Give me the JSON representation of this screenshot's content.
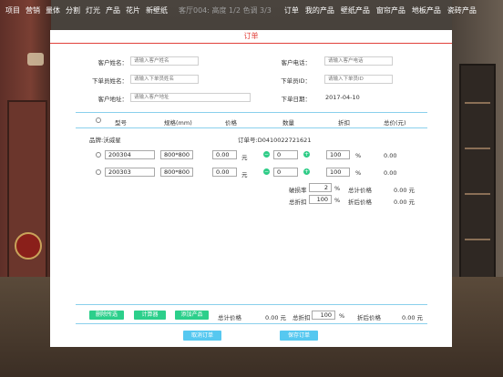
{
  "topbar": {
    "left_menu": [
      "项目",
      "营销",
      "量体",
      "分割",
      "灯光",
      "产品",
      "花片",
      "新壁纸"
    ],
    "scene_info": "客厅004: 高度 1/2 色调 3/3",
    "right_menu": [
      "订单",
      "我的产品",
      "壁纸产品",
      "窗帘产品",
      "地板产品",
      "瓷砖产品"
    ]
  },
  "dialog": {
    "title": "订单",
    "customer_name_label": "客户姓名：",
    "customer_name_placeholder": "请输入客户姓名",
    "customer_phone_label": "客户电话：",
    "customer_phone_placeholder": "请输入客户电话",
    "orderer_name_label": "下单员姓名：",
    "orderer_name_placeholder": "请输入下单员姓名",
    "orderer_id_label": "下单员ID：",
    "orderer_id_placeholder": "请输入下单员ID",
    "customer_address_label": "客户地址：",
    "customer_address_placeholder": "请输入客户地址",
    "order_date_label": "下单日期：",
    "order_date": "2017-04-10"
  },
  "table": {
    "headers": [
      "型号",
      "规格(mm)",
      "价格",
      "数量",
      "折扣",
      "总价(元)"
    ],
    "brand_label": "品牌:沃威星",
    "order_no": "订单号:D0410022721621",
    "rows": [
      {
        "model": "200304",
        "spec": "800*800",
        "price": "0.00",
        "unit": "元",
        "qty": "0",
        "minus": "−",
        "plus": "+",
        "discount": "100",
        "pct": "%",
        "total": "0.00"
      },
      {
        "model": "200303",
        "spec": "800*800",
        "price": "0.00",
        "unit": "元",
        "qty": "0",
        "minus": "−",
        "plus": "+",
        "discount": "100",
        "pct": "%",
        "total": "0.00"
      }
    ]
  },
  "subtotal": {
    "breakage_label": "破损率",
    "breakage_value": "2",
    "breakage_pct": "%",
    "total_price_label": "总计价格",
    "total_price_value": "0.00 元",
    "total_discount_label": "总折扣",
    "total_discount_value": "100",
    "total_discount_pct": "%",
    "discounted_label": "折后价格",
    "discounted_value": "0.00 元"
  },
  "footer": {
    "delete_selected": "删除所选",
    "calculator": "计算器",
    "add_product": "添加产品",
    "total_price_label": "总计价格",
    "total_price_value": "0.00 元",
    "total_discount_label": "总折扣",
    "total_discount_value": "100",
    "total_discount_pct": "%",
    "discounted_label": "折后价格",
    "discounted_value": "0.00 元",
    "cancel_order": "取消订单",
    "save_order": "保存订单"
  },
  "colors": {
    "accent_red": "#e1403a",
    "divider_blue": "#8ad0ec",
    "button_green": "#2ccf8b",
    "button_blue": "#56c8f0"
  }
}
